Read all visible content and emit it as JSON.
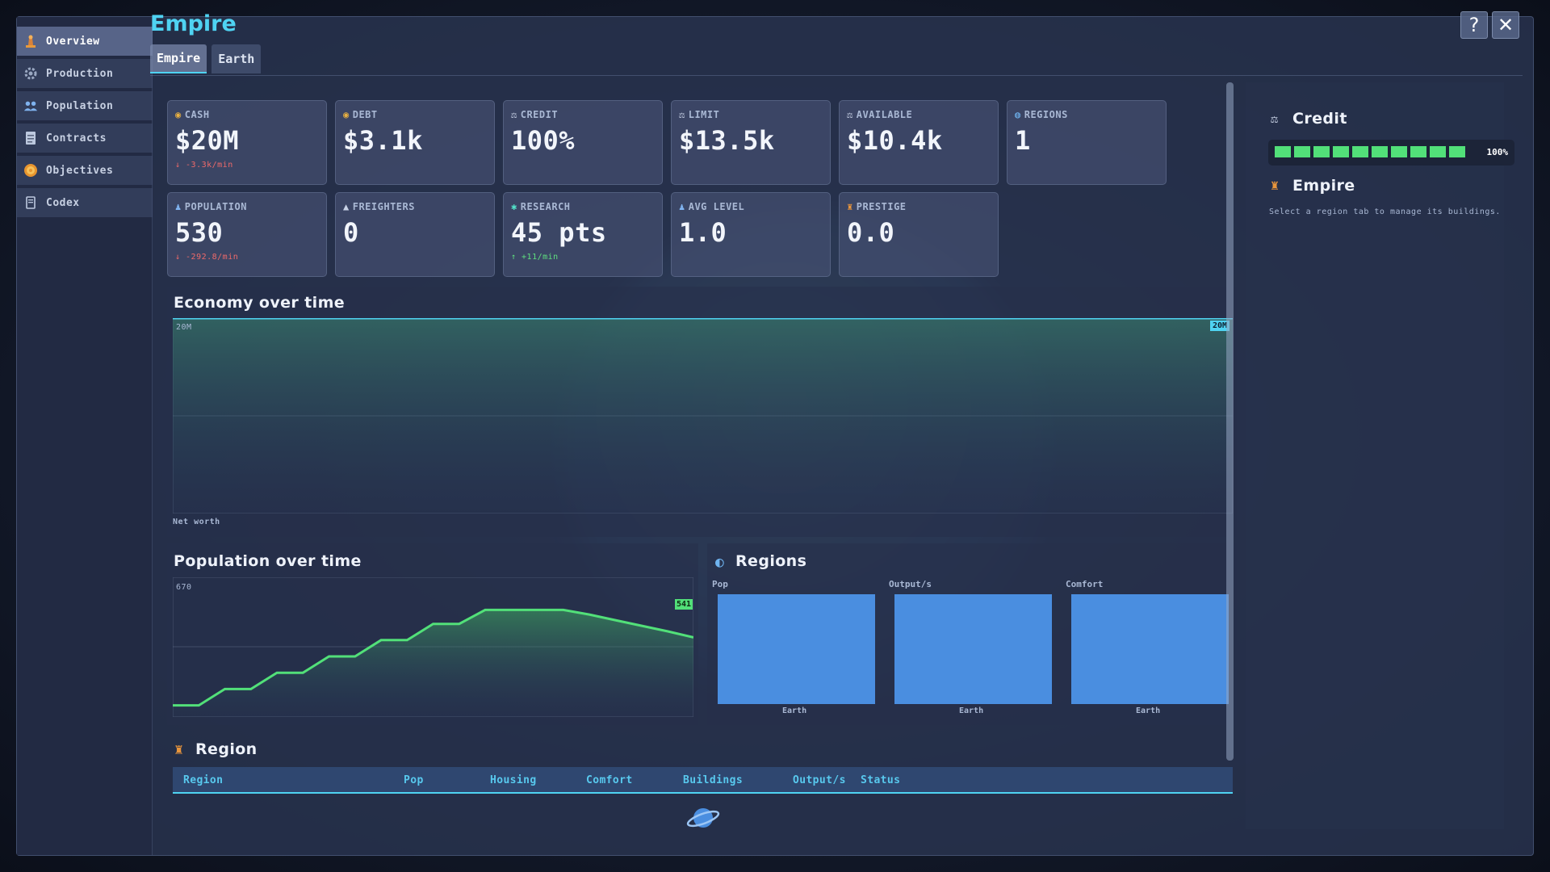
{
  "sidebar": {
    "items": [
      {
        "label": "Overview",
        "icon": "empire-icon",
        "active": true
      },
      {
        "label": "Production",
        "icon": "gear-icon"
      },
      {
        "label": "Population",
        "icon": "people-icon"
      },
      {
        "label": "Contracts",
        "icon": "document-icon"
      },
      {
        "label": "Objectives",
        "icon": "target-icon"
      },
      {
        "label": "Codex",
        "icon": "book-icon"
      }
    ]
  },
  "header": {
    "title": "Empire",
    "help_label": "?",
    "close_label": "✕",
    "tabs": [
      {
        "label": "Empire",
        "active": true
      },
      {
        "label": "Earth",
        "active": false
      }
    ]
  },
  "stats": {
    "cash": {
      "label": "CASH",
      "value": "$20M",
      "delta": "↓ -3.3k/min"
    },
    "debt": {
      "label": "DEBT",
      "value": "$3.1k"
    },
    "credit": {
      "label": "CREDIT",
      "value": "100%"
    },
    "limit": {
      "label": "LIMIT",
      "value": "$13.5k"
    },
    "available": {
      "label": "AVAILABLE",
      "value": "$10.4k"
    },
    "regions": {
      "label": "REGIONS",
      "value": "1"
    },
    "population": {
      "label": "POPULATION",
      "value": "530",
      "delta": "↓ -292.8/min"
    },
    "freighters": {
      "label": "FREIGHTERS",
      "value": "0"
    },
    "research": {
      "label": "RESEARCH",
      "value": "45 pts",
      "delta": "↑ +11/min"
    },
    "avg_level": {
      "label": "AVG LEVEL",
      "value": "1.0"
    },
    "prestige": {
      "label": "PRESTIGE",
      "value": "0.0"
    }
  },
  "economy_chart": {
    "title": "Economy over time",
    "top_label": "20M",
    "current_badge": "20M",
    "series_label": "Net worth"
  },
  "population_chart": {
    "title": "Population over time",
    "top_label": "670",
    "current_badge": "541"
  },
  "regions_chart": {
    "title": "Regions",
    "groups": [
      {
        "label": "Pop",
        "category": "Earth"
      },
      {
        "label": "Output/s",
        "category": "Earth"
      },
      {
        "label": "Comfort",
        "category": "Earth"
      }
    ]
  },
  "chart_data": [
    {
      "type": "area",
      "ylabel": "Net worth",
      "ylim": [
        0,
        20000000
      ],
      "series": [
        {
          "values": [
            20000000,
            20000000,
            20000000,
            20000000,
            20000000,
            20000000,
            20000000,
            20000000,
            20000000,
            20000000,
            20000000
          ]
        }
      ],
      "grid": true
    },
    {
      "type": "area",
      "ylim": [
        370,
        670
      ],
      "series": [
        {
          "values": [
            395,
            395,
            430,
            430,
            465,
            465,
            500,
            500,
            535,
            535,
            570,
            570,
            600,
            600,
            600,
            600,
            590,
            578,
            566,
            554,
            541
          ]
        }
      ],
      "grid": true
    },
    {
      "type": "bar",
      "categories": [
        "Earth",
        "Earth",
        "Earth"
      ],
      "series": [
        {
          "name": "Pop",
          "values": [
            1
          ]
        },
        {
          "name": "Output/s",
          "values": [
            1
          ]
        },
        {
          "name": "Comfort",
          "values": [
            1
          ]
        }
      ]
    }
  ],
  "region_table": {
    "title": "Region",
    "columns": [
      "Region",
      "Pop",
      "Housing",
      "Comfort",
      "Buildings",
      "Output/s",
      "Status"
    ]
  },
  "right_panel": {
    "credit_title": "Credit",
    "credit_percent": "100%",
    "credit_fraction": 1.0,
    "empire_title": "Empire",
    "hint": "Select a region tab to manage its buildings."
  },
  "colors": {
    "accent": "#4fd3f2",
    "positive": "#5fe07f",
    "negative": "#ef6a6a",
    "bar": "#4a8ee0"
  }
}
